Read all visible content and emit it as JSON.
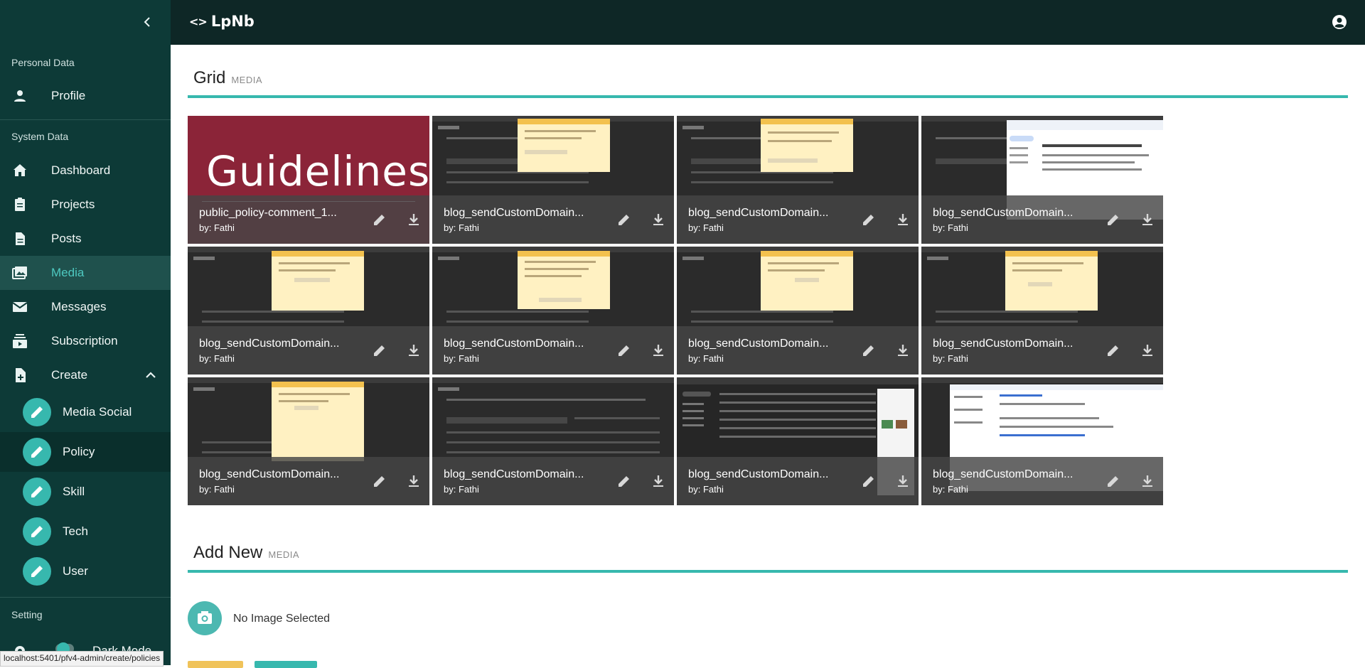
{
  "app": {
    "logo": "LpNb"
  },
  "colors": {
    "topbar": "#0e2726",
    "sidebar": "#0d3a37",
    "accent": "#37b8ae",
    "active_bg": "#1f514d"
  },
  "sidebar": {
    "personal_heading": "Personal Data",
    "profile_label": "Profile",
    "system_heading": "System Data",
    "items": [
      {
        "label": "Dashboard",
        "icon": "home-icon"
      },
      {
        "label": "Projects",
        "icon": "clipboard-icon"
      },
      {
        "label": "Posts",
        "icon": "document-icon"
      },
      {
        "label": "Media",
        "icon": "image-icon",
        "active": true
      },
      {
        "label": "Messages",
        "icon": "mail-icon"
      },
      {
        "label": "Subscription",
        "icon": "subscriptions-icon"
      }
    ],
    "create_label": "Create",
    "create_items": [
      {
        "label": "Media Social"
      },
      {
        "label": "Policy",
        "hovered": true
      },
      {
        "label": "Skill"
      },
      {
        "label": "Tech"
      },
      {
        "label": "User"
      }
    ],
    "setting_heading": "Setting",
    "dark_mode_label": "Dark Mode"
  },
  "grid_section": {
    "title": "Grid",
    "subtitle": "MEDIA"
  },
  "tiles": [
    {
      "title": "public_policy-comment_1...",
      "author": "by: Fathi",
      "image": "guidelines-banner",
      "banner_text": "Guidelines"
    },
    {
      "title": "blog_sendCustomDomain...",
      "author": "by: Fathi",
      "image": "cpanel-screenshot"
    },
    {
      "title": "blog_sendCustomDomain...",
      "author": "by: Fathi",
      "image": "cpanel-screenshot"
    },
    {
      "title": "blog_sendCustomDomain...",
      "author": "by: Fathi",
      "image": "gmail-screenshot"
    },
    {
      "title": "blog_sendCustomDomain...",
      "author": "by: Fathi",
      "image": "cpanel-screenshot"
    },
    {
      "title": "blog_sendCustomDomain...",
      "author": "by: Fathi",
      "image": "cpanel-screenshot"
    },
    {
      "title": "blog_sendCustomDomain...",
      "author": "by: Fathi",
      "image": "cpanel-screenshot"
    },
    {
      "title": "blog_sendCustomDomain...",
      "author": "by: Fathi",
      "image": "cpanel-screenshot"
    },
    {
      "title": "blog_sendCustomDomain...",
      "author": "by: Fathi",
      "image": "cpanel-screenshot"
    },
    {
      "title": "blog_sendCustomDomain...",
      "author": "by: Fathi",
      "image": "cpanel-screenshot"
    },
    {
      "title": "blog_sendCustomDomain...",
      "author": "by: Fathi",
      "image": "gmail-screenshot"
    },
    {
      "title": "blog_sendCustomDomain...",
      "author": "by: Fathi",
      "image": "gmail-settings-screenshot"
    }
  ],
  "add_section": {
    "title": "Add New",
    "subtitle": "MEDIA",
    "no_image_text": "No Image Selected"
  },
  "status_url": "localhost:5401/pfv4-admin/create/policies"
}
